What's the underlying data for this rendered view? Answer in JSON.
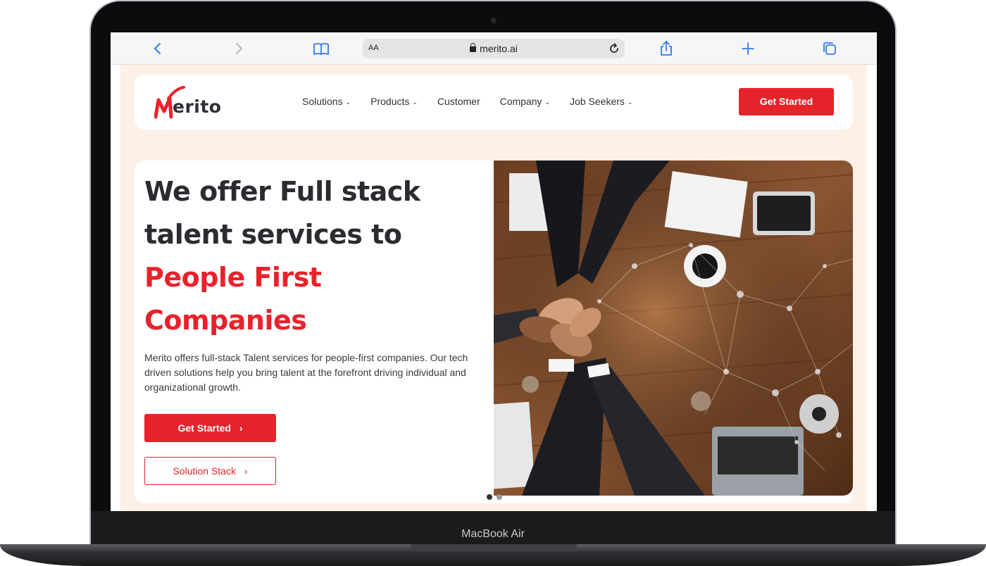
{
  "device": {
    "label": "MacBook Air"
  },
  "browser": {
    "url": "merito.ai",
    "aa_label": "AA",
    "icons": [
      "back-icon",
      "forward-icon",
      "bookmarks-icon",
      "lock-icon",
      "reload-icon",
      "share-icon",
      "new-tab-icon",
      "tabs-icon"
    ]
  },
  "navbar": {
    "logo_text": "erito",
    "logo_alt": "Merito",
    "items": [
      {
        "label": "Solutions",
        "has_dropdown": true
      },
      {
        "label": "Products",
        "has_dropdown": true
      },
      {
        "label": "Customer",
        "has_dropdown": false
      },
      {
        "label": "Company",
        "has_dropdown": true
      },
      {
        "label": "Job Seekers",
        "has_dropdown": true
      }
    ],
    "cta_label": "Get Started"
  },
  "hero": {
    "title_line1": "We offer Full stack",
    "title_line2": "talent services to",
    "title_highlight1": "People First",
    "title_highlight2": "Companies",
    "description": "Merito offers full-stack Talent services for people-first companies. Our tech driven solutions help you bring talent at the forefront driving individual and organizational growth.",
    "primary_button": "Get Started",
    "secondary_button": "Solution Stack",
    "carousel": {
      "slides": 2,
      "active": 1
    }
  },
  "colors": {
    "brand_red": "#e8222b",
    "page_bg": "#fdf0e6",
    "text_dark": "#2b2b31",
    "link_blue": "#2f7bf6"
  }
}
